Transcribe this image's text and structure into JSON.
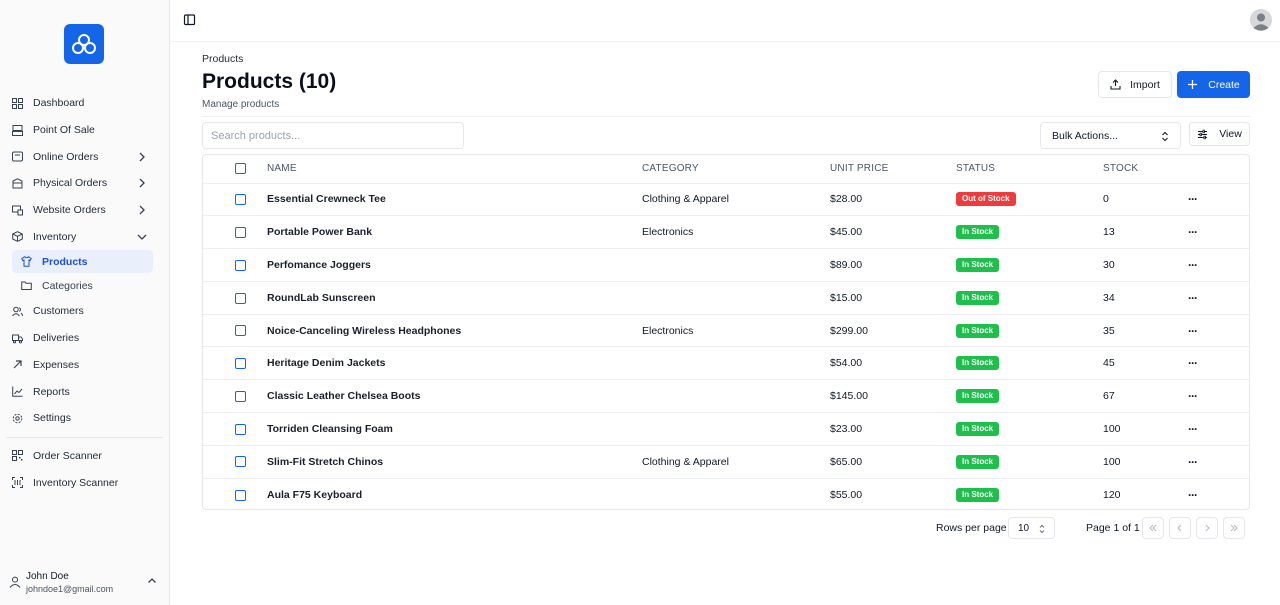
{
  "sidebar": {
    "nav": [
      {
        "label": "Dashboard",
        "icon": "dashboard-icon"
      },
      {
        "label": "Point Of Sale",
        "icon": "pos-icon"
      },
      {
        "label": "Online Orders",
        "icon": "online-orders-icon"
      },
      {
        "label": "Physical Orders",
        "icon": "physical-orders-icon"
      },
      {
        "label": "Website Orders",
        "icon": "website-orders-icon"
      },
      {
        "label": "Inventory",
        "icon": "box-icon"
      }
    ],
    "inventory_sub": [
      {
        "label": "Products",
        "icon": "shirt-icon"
      },
      {
        "label": "Categories",
        "icon": "folder-icon"
      }
    ],
    "nav2": [
      {
        "label": "Customers",
        "icon": "users-icon"
      },
      {
        "label": "Deliveries",
        "icon": "truck-icon"
      },
      {
        "label": "Expenses",
        "icon": "arrow-up-right-icon"
      },
      {
        "label": "Reports",
        "icon": "chart-icon"
      },
      {
        "label": "Settings",
        "icon": "gear-icon"
      }
    ],
    "nav3": [
      {
        "label": "Order Scanner",
        "icon": "qr-icon"
      },
      {
        "label": "Inventory Scanner",
        "icon": "scan-icon"
      }
    ],
    "user": {
      "name": "John Doe",
      "email": "johndoe1@gmail.com"
    }
  },
  "header": {
    "breadcrumb": "Products",
    "title": "Products (10)",
    "subtitle": "Manage products",
    "import_label": "Import",
    "create_label": "Create"
  },
  "toolbar": {
    "search_placeholder": "Search products...",
    "bulk_label": "Bulk Actions...",
    "view_label": "View"
  },
  "table": {
    "columns": [
      "NAME",
      "CATEGORY",
      "UNIT PRICE",
      "STATUS",
      "STOCK"
    ],
    "rows": [
      {
        "name": "Essential Crewneck Tee",
        "category": "Clothing & Apparel",
        "price": "$28.00",
        "status": "Out of Stock",
        "stock": "0"
      },
      {
        "name": "Portable Power Bank",
        "category": "Electronics",
        "price": "$45.00",
        "status": "In Stock",
        "stock": "13"
      },
      {
        "name": "Perfomance Joggers",
        "category": "",
        "price": "$89.00",
        "status": "In Stock",
        "stock": "30"
      },
      {
        "name": "RoundLab Sunscreen",
        "category": "",
        "price": "$15.00",
        "status": "In Stock",
        "stock": "34"
      },
      {
        "name": "Noice-Canceling Wireless Headphones",
        "category": "Electronics",
        "price": "$299.00",
        "status": "In Stock",
        "stock": "35"
      },
      {
        "name": "Heritage Denim Jackets",
        "category": "",
        "price": "$54.00",
        "status": "In Stock",
        "stock": "45"
      },
      {
        "name": "Classic Leather Chelsea Boots",
        "category": "",
        "price": "$145.00",
        "status": "In Stock",
        "stock": "67"
      },
      {
        "name": "Torriden Cleansing Foam",
        "category": "",
        "price": "$23.00",
        "status": "In Stock",
        "stock": "100"
      },
      {
        "name": "Slim-Fit Stretch Chinos",
        "category": "Clothing & Apparel",
        "price": "$65.00",
        "status": "In Stock",
        "stock": "100"
      },
      {
        "name": "Aula F75 Keyboard",
        "category": "",
        "price": "$55.00",
        "status": "In Stock",
        "stock": "120"
      }
    ]
  },
  "pagination": {
    "rows_per_page_label": "Rows per page",
    "rows_per_page_value": "10",
    "page_label": "Page 1 of 1"
  },
  "colors": {
    "accent": "#1565e8",
    "in_stock": "#1fbf4c",
    "out_of_stock": "#ef3b3b"
  }
}
